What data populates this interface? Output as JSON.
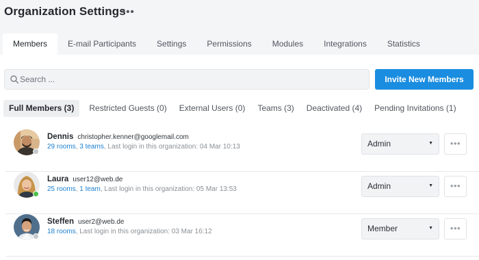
{
  "page": {
    "title": "Organization Settings",
    "more_label": "•••"
  },
  "tabs": [
    {
      "label": "Members",
      "active": true
    },
    {
      "label": "E-mail Participants",
      "active": false
    },
    {
      "label": "Settings",
      "active": false
    },
    {
      "label": "Permissions",
      "active": false
    },
    {
      "label": "Modules",
      "active": false
    },
    {
      "label": "Integrations",
      "active": false
    },
    {
      "label": "Statistics",
      "active": false
    }
  ],
  "search": {
    "placeholder": "Search ...",
    "icon": "search-icon"
  },
  "invite_button": {
    "label": "Invite New Members",
    "color": "#1a8de0"
  },
  "filters": [
    {
      "label": "Full Members (3)",
      "active": true
    },
    {
      "label": "Restricted Guests (0)",
      "active": false
    },
    {
      "label": "External Users (0)",
      "active": false
    },
    {
      "label": "Teams (3)",
      "active": false
    },
    {
      "label": "Deactivated (4)",
      "active": false
    },
    {
      "label": "Pending Invitations (1)",
      "active": false
    }
  ],
  "members": [
    {
      "name": "Dennis",
      "email": "christopher.kenner@googlemail.com",
      "rooms": "29 rooms",
      "sep": ", ",
      "teams": "3 teams",
      "last_login": ", Last login in this organization: 04 Mar 10:13",
      "role": "Admin",
      "status_color": "#c4c7cb",
      "more_label": "•••"
    },
    {
      "name": "Laura",
      "email": "user12@web.de",
      "rooms": "25 rooms",
      "sep": ", ",
      "teams": "1 team",
      "last_login": ", Last login in this organization: 05 Mar 13:53",
      "role": "Admin",
      "status_color": "#4cc24c",
      "more_label": "•••"
    },
    {
      "name": "Steffen",
      "email": "user2@web.de",
      "rooms": "18 rooms",
      "sep": "",
      "teams": "",
      "last_login": ", Last login in this organization: 03 Mar 16:12",
      "role": "Member",
      "status_color": "#c4c7cb",
      "more_label": "•••"
    }
  ],
  "colors": {
    "link": "#1a7fd0",
    "header_bg": "#f4f5f7",
    "online": "#4cc24c",
    "offline": "#c4c7cb"
  }
}
